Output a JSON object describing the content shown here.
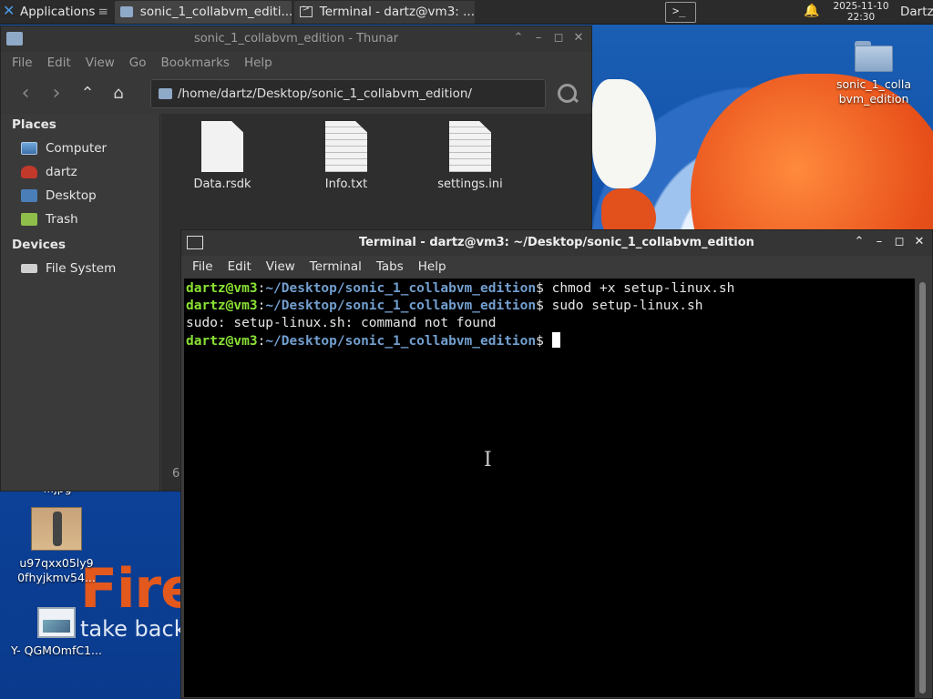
{
  "panel": {
    "applications": "Applications",
    "tasks": [
      {
        "label": "sonic_1_collabvm_editi..."
      },
      {
        "label": "Terminal - dartz@vm3: ..."
      }
    ],
    "clock_date": "2025-11-10",
    "clock_time": "22:30",
    "user": "Dartz"
  },
  "desktop": {
    "icons": [
      {
        "label": "sonic_1_colla bvm_edition"
      },
      {
        "label_partial": "...jpg"
      },
      {
        "label": "u97qxx05ly9 0fhyjkmv54..."
      },
      {
        "label": "Y- QGMOmfC1..."
      }
    ],
    "wallpaper_text": {
      "brand": "Fire",
      "tagline": "take back"
    }
  },
  "thunar": {
    "title": "sonic_1_collabvm_edition - Thunar",
    "menu": [
      "File",
      "Edit",
      "View",
      "Go",
      "Bookmarks",
      "Help"
    ],
    "path": "/home/dartz/Desktop/sonic_1_collabvm_edition/",
    "places_header": "Places",
    "places": [
      {
        "label": "Computer",
        "icon": "computer-icon"
      },
      {
        "label": "dartz",
        "icon": "home-icon"
      },
      {
        "label": "Desktop",
        "icon": "desktop-icon"
      },
      {
        "label": "Trash",
        "icon": "trash-icon"
      }
    ],
    "devices_header": "Devices",
    "devices": [
      {
        "label": "File System",
        "icon": "drive-icon"
      }
    ],
    "files": [
      {
        "name": "Data.rsdk"
      },
      {
        "name": "Info.txt"
      },
      {
        "name": "settings.ini"
      }
    ],
    "status_fragment": "6"
  },
  "terminal": {
    "title": "Terminal - dartz@vm3: ~/Desktop/sonic_1_collabvm_edition",
    "menu": [
      "File",
      "Edit",
      "View",
      "Terminal",
      "Tabs",
      "Help"
    ],
    "prompt_user": "dartz@vm3",
    "prompt_sep": ":",
    "prompt_cwd": "~/Desktop/sonic_1_collabvm_edition",
    "prompt_end": "$ ",
    "lines": [
      {
        "type": "prompt",
        "command": "chmod +x setup-linux.sh"
      },
      {
        "type": "prompt",
        "command": "sudo setup-linux.sh"
      },
      {
        "type": "output",
        "text": "sudo: setup-linux.sh: command not found"
      },
      {
        "type": "prompt",
        "command": ""
      }
    ]
  },
  "colors": {
    "prompt_user": "#8ae234",
    "prompt_cwd": "#729fcf",
    "panel_bg": "#2b2b2b",
    "window_bg": "#383838"
  }
}
